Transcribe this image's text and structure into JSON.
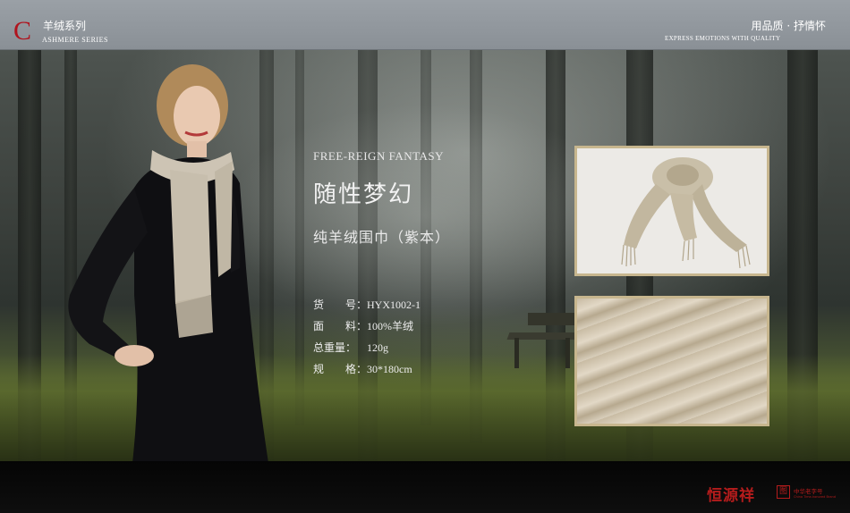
{
  "header": {
    "logo_letter": "C",
    "series_cn": "羊绒系列",
    "series_en": "ASHMERE SERIES",
    "slogan_cn": "用品质 · 抒情怀",
    "slogan_en": "EXPRESS EMOTIONS WITH QUALITY"
  },
  "product": {
    "name_en": "FREE-REIGN FANTASY",
    "name_cn": "随性梦幻",
    "subtitle": "纯羊绒围巾（紫本）",
    "specs": [
      {
        "label": "货　　号：",
        "value": "HYX1002-1"
      },
      {
        "label": "面　　料：",
        "value": "100%羊绒"
      },
      {
        "label": "总重量：",
        "value": "120g"
      },
      {
        "label": "规　　格：",
        "value": "30*180cm"
      }
    ]
  },
  "footer": {
    "brand": "恒源祥",
    "seal_char": "图",
    "award_cn": "中华老字号",
    "award_en": "China Time-honored Brand"
  },
  "colors": {
    "accent_red": "#b51c1c",
    "frame_gold": "#c7b68e",
    "header_gray": "#9aa0a6"
  }
}
